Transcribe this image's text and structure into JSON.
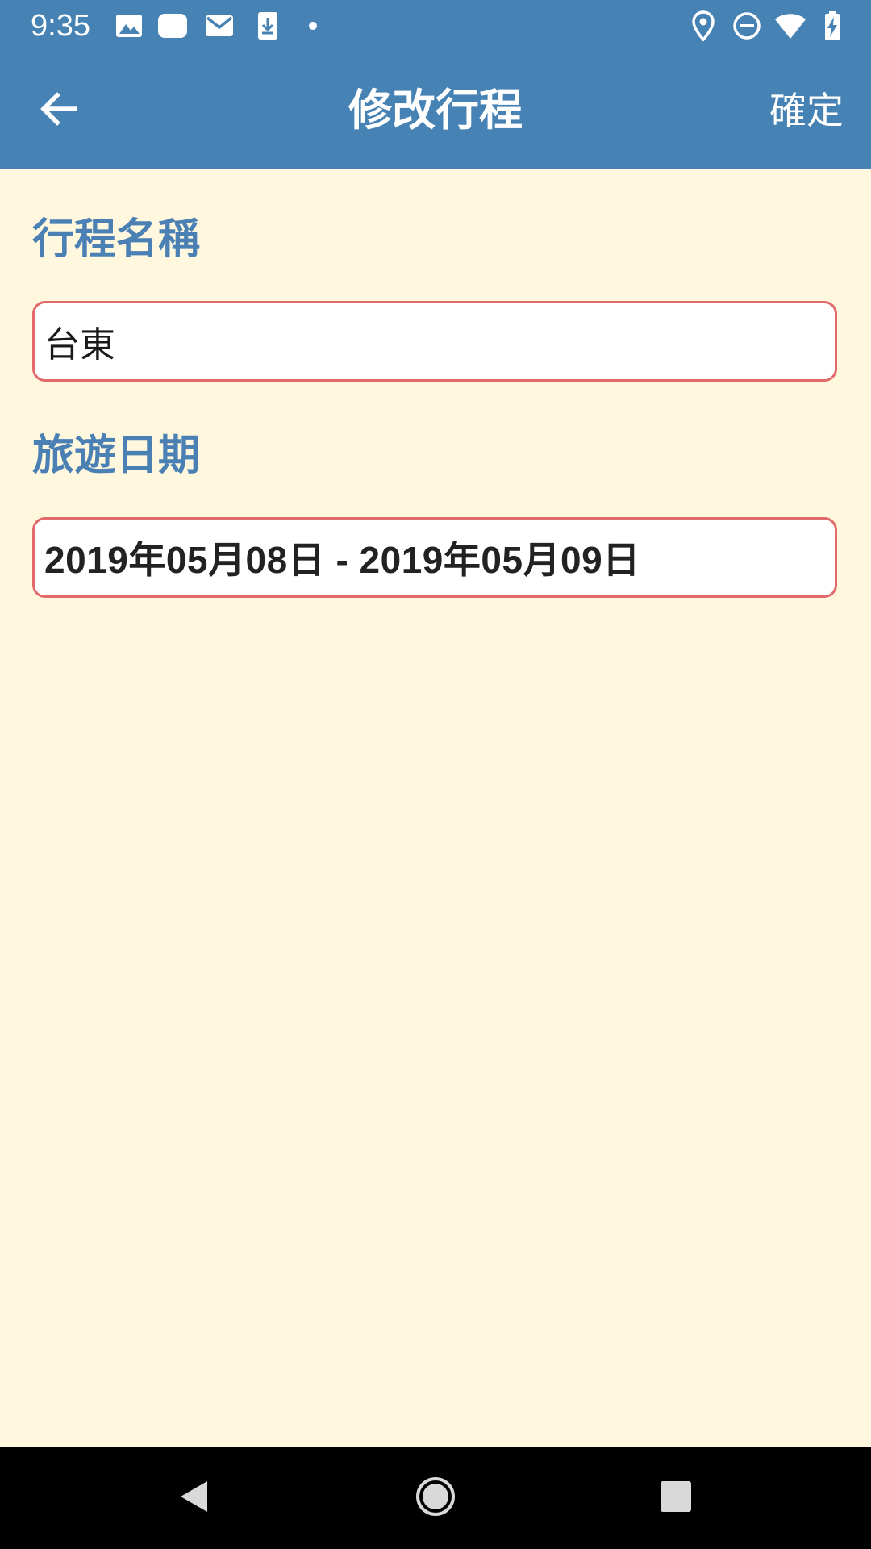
{
  "status_bar": {
    "time": "9:35",
    "left_icons": [
      "image-icon",
      "notification-blob-icon",
      "gmail-icon",
      "download-icon",
      "dot-icon"
    ],
    "right_icons": [
      "location-icon",
      "do-not-disturb-icon",
      "wifi-icon",
      "battery-charging-icon"
    ]
  },
  "app_bar": {
    "back_icon": "arrow-left-icon",
    "title": "修改行程",
    "confirm_label": "確定"
  },
  "form": {
    "name_label": "行程名稱",
    "name_value": "台東",
    "date_label": "旅遊日期",
    "date_value": "2019年05月08日 - 2019年05月09日"
  },
  "nav_bar": {
    "icons": [
      "back-triangle-icon",
      "home-circle-icon",
      "recents-square-icon"
    ]
  },
  "colors": {
    "app_bar": "#4682B4",
    "background": "#FFF7DE",
    "label": "#4A80B4",
    "field_border": "#E26A6A"
  }
}
